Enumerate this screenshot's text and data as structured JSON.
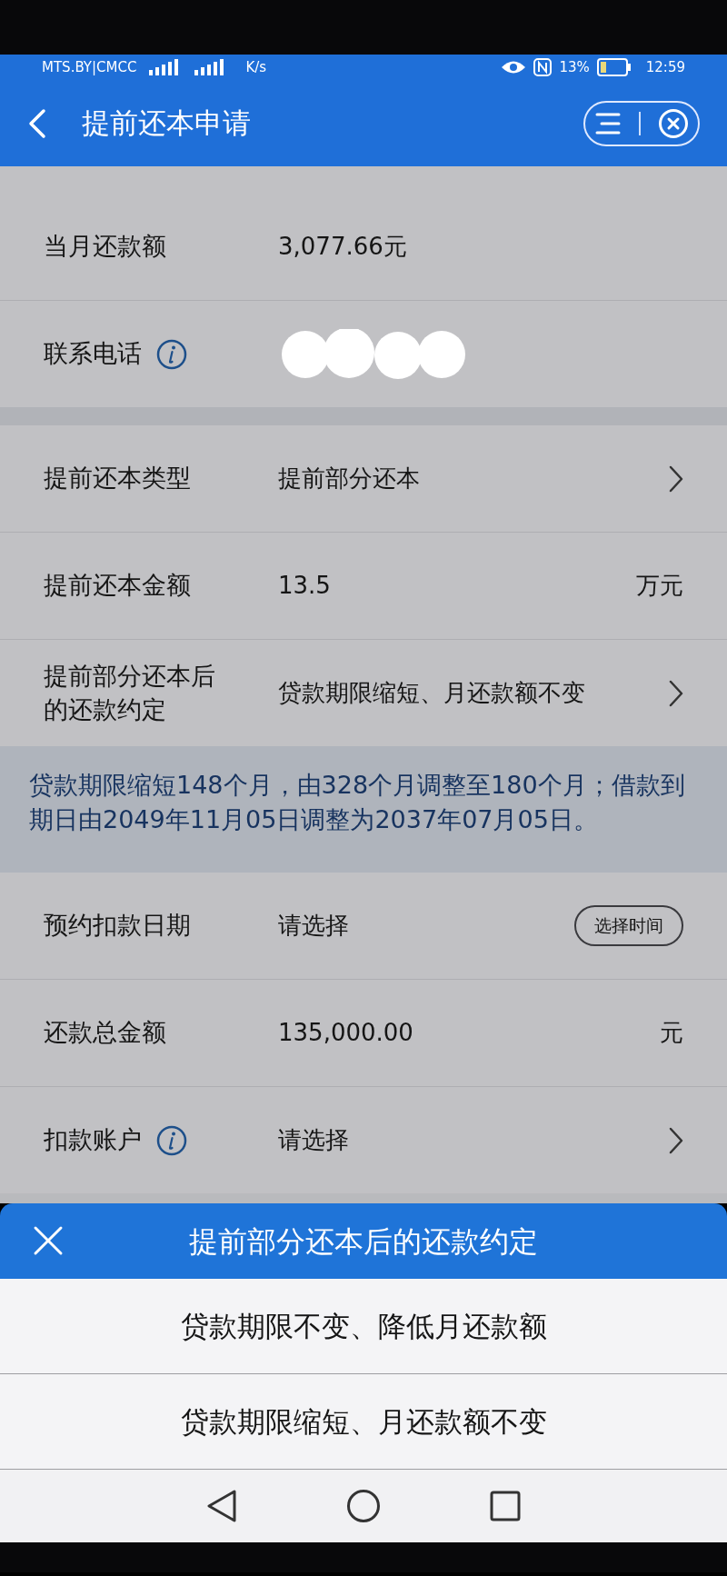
{
  "status_bar": {
    "carrier": "MTS.BY|CMCC",
    "speed_unit": "K/s",
    "battery": "13%",
    "time": "12:59"
  },
  "header": {
    "title": "提前还本申请"
  },
  "groups": [
    {
      "rows": [
        {
          "label": "当月还款额",
          "value": "3,077.66元",
          "kind": "plain"
        },
        {
          "label": "联系电话",
          "kind": "redacted",
          "info": true
        }
      ]
    },
    {
      "rows": [
        {
          "label": "提前还本类型",
          "value": "提前部分还本",
          "kind": "chevron"
        },
        {
          "label": "提前还本金额",
          "value": "13.5",
          "suffix": "万元",
          "kind": "suffix"
        },
        {
          "label": "提前部分还本后的还款约定",
          "value": "贷款期限缩短、月还款额不变",
          "kind": "chevron"
        }
      ],
      "note": "贷款期限缩短148个月，由328个月调整至180个月；借款到期日由2049年11月05日调整为2037年07月05日。"
    },
    {
      "rows": [
        {
          "label": "预约扣款日期",
          "value": "请选择",
          "button": "选择时间",
          "kind": "button"
        },
        {
          "label": "还款总金额",
          "value": "135,000.00",
          "suffix": "元",
          "kind": "suffix"
        },
        {
          "label": "扣款账户",
          "value": "请选择",
          "kind": "chevron",
          "info": true
        }
      ]
    }
  ],
  "sheet": {
    "title": "提前部分还本后的还款约定",
    "options": [
      {
        "label": "贷款期限不变、降低月还款额"
      },
      {
        "label": "贷款期限缩短、月还款额不变"
      }
    ]
  }
}
